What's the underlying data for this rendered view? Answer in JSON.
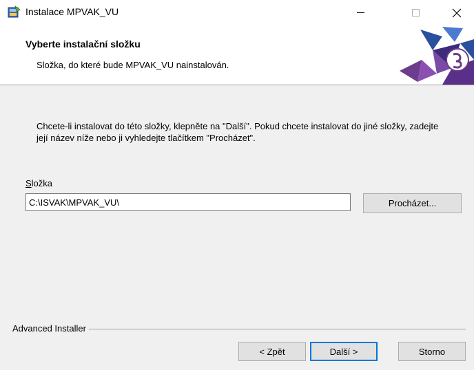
{
  "window": {
    "title": "Instalace MPVAK_VU",
    "controls": {
      "minimize_icon": "minimize-icon",
      "maximize_icon": "maximize-icon",
      "close_icon": "close-icon"
    }
  },
  "header": {
    "title": "Vyberte instalační složku",
    "subtitle": "Složka, do které bude MPVAK_VU nainstalován."
  },
  "main": {
    "description": "Chcete-li instalovat do této složky, klepněte na \"Další\". Pokud chcete instalovat do jiné složky, zadejte její název níže nebo ji vyhledejte tlačítkem \"Procházet\".",
    "folder_label_accel": "S",
    "folder_label_rest": "ložka",
    "folder_value": "C:\\ISVAK\\MPVAK_VU\\",
    "browse_label": "Procházet..."
  },
  "footer": {
    "brand": "Advanced Installer",
    "back_label": "< Zpět",
    "next_label": "Další >",
    "cancel_label": "Storno"
  },
  "colors": {
    "accent": "#0078d7",
    "logo_purple": "#6b3d8c",
    "logo_blue": "#2a4f9e"
  }
}
